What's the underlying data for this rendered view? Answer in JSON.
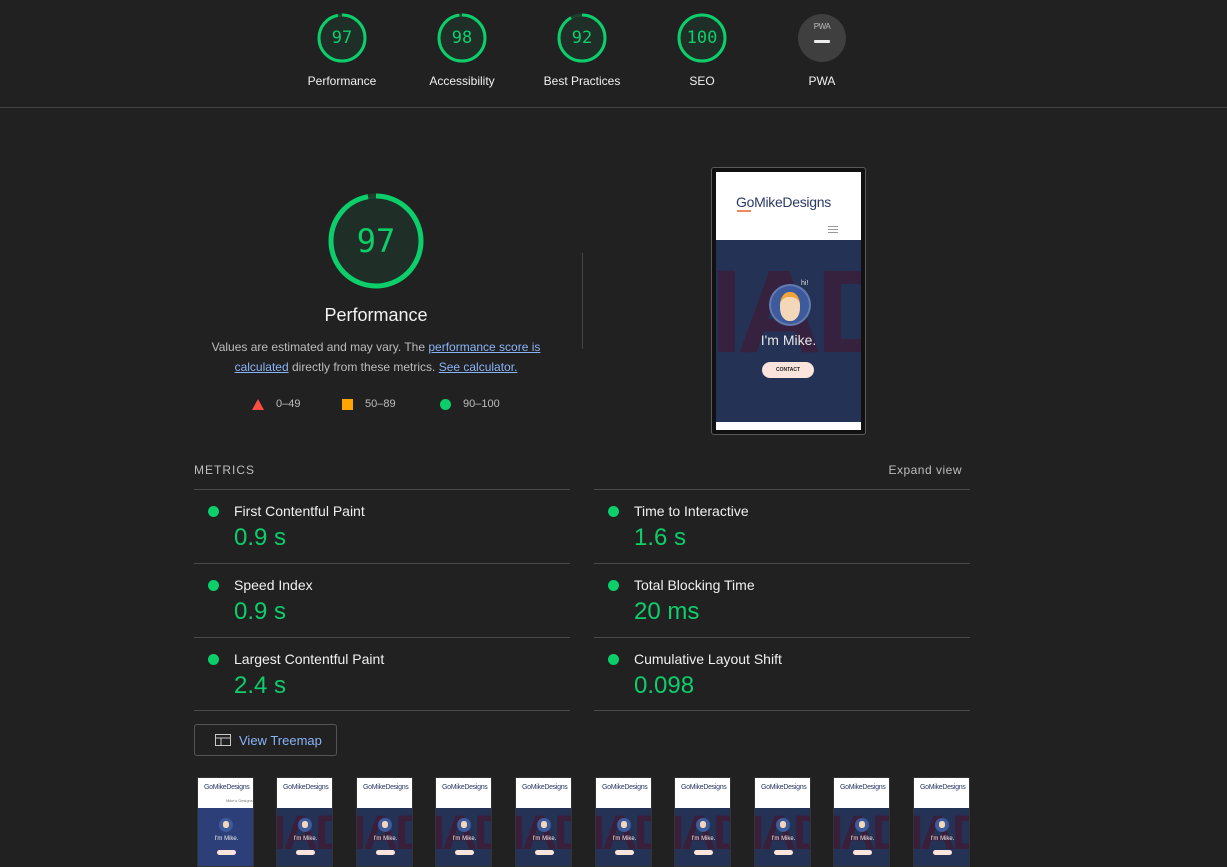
{
  "summary": [
    {
      "label": "Performance",
      "score": "97",
      "value": 97
    },
    {
      "label": "Accessibility",
      "score": "98",
      "value": 98
    },
    {
      "label": "Best Practices",
      "score": "92",
      "value": 92
    },
    {
      "label": "SEO",
      "score": "100",
      "value": 100
    }
  ],
  "pwa": {
    "label": "PWA",
    "badge_text": "PWA"
  },
  "performance": {
    "score": "97",
    "score_value": 97,
    "title": "Performance",
    "desc_prefix": "Values are estimated and may vary. The ",
    "link_score": "performance score is calculated",
    "desc_middle": " directly from these metrics. ",
    "link_calculator": "See calculator."
  },
  "legend": {
    "fail": "0–49",
    "average": "50–89",
    "pass": "90–100"
  },
  "screenshot": {
    "logo": "GoMikeDesigns",
    "greeting": "hi!",
    "headline": "I'm Mike.",
    "cta": "CONTACT"
  },
  "metrics": {
    "heading": "METRICS",
    "expand": "Expand view",
    "items": [
      {
        "name": "First Contentful Paint",
        "value": "0.9 s"
      },
      {
        "name": "Time to Interactive",
        "value": "1.6 s"
      },
      {
        "name": "Speed Index",
        "value": "0.9 s"
      },
      {
        "name": "Total Blocking Time",
        "value": "20 ms"
      },
      {
        "name": "Largest Contentful Paint",
        "value": "2.4 s"
      },
      {
        "name": "Cumulative Layout Shift",
        "value": "0.098"
      }
    ]
  },
  "treemap": {
    "label": "View Treemap"
  },
  "filmstrip": {
    "logo": "GoMikeDesigns",
    "headline": "I'm Mike.",
    "first_subtext": "Mike's Designs",
    "count": 10
  },
  "colors": {
    "pass": "#0cce6b",
    "average": "#ffa400",
    "fail": "#ff4e42",
    "link": "#8ab4f8",
    "background": "#212121"
  }
}
